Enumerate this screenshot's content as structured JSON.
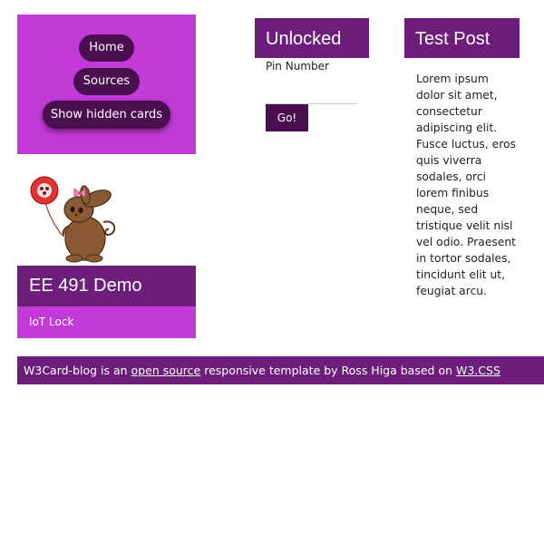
{
  "nav": {
    "home_label": "Home",
    "sources_label": "Sources",
    "show_hidden_label": "Show hidden cards"
  },
  "profile": {
    "title": "EE 491 Demo",
    "subtitle": "IoT Lock",
    "image": "bunny-with-balloon-mascot"
  },
  "unlock_card": {
    "title": "Unlocked",
    "pin_label": "Pin Number",
    "pin_value": "",
    "go_label": "Go!"
  },
  "post_card": {
    "title": "Test Post",
    "body": "Lorem ipsum dolor sit amet, consectetur adipiscing elit. Fusce luctus, eros quis viverra sodales, orci lorem finibus neque, sed tristique velit nisl vel odio. Praesent in tortor sodales, tincidunt elit ut, feugiat arcu."
  },
  "footer": {
    "text_before": "W3Card-blog is an ",
    "link1": "open source",
    "text_middle": " responsive template by Ross Higa based on ",
    "link2": "W3.CSS"
  },
  "colors": {
    "accent_light": "#c23bd9",
    "accent_dark": "#6d1e7b",
    "button_dark": "#4a0f4f"
  }
}
